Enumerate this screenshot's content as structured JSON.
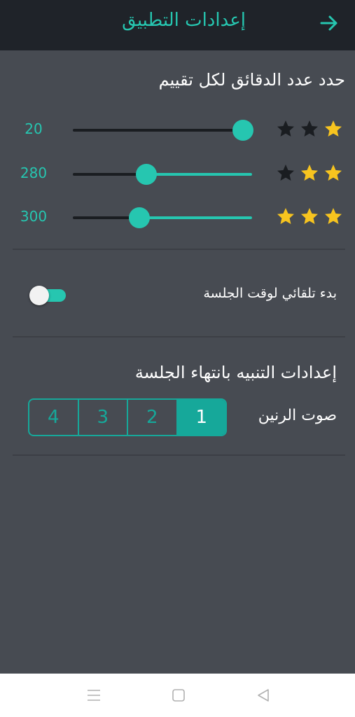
{
  "header": {
    "title": "إعدادات التطبيق",
    "back_icon": "arrow-right-icon"
  },
  "minutes_section": {
    "title": "حدد عدد الدقائق لكل تقييم",
    "rows": [
      {
        "value": "20",
        "stars_filled": 1,
        "stars_total": 3,
        "slider_fraction": 0.95
      },
      {
        "value": "280",
        "stars_filled": 2,
        "stars_total": 3,
        "slider_fraction": 0.41
      },
      {
        "value": "300",
        "stars_filled": 3,
        "stars_total": 3,
        "slider_fraction": 0.37
      }
    ]
  },
  "auto_start": {
    "label": "بدء تلقائي لوقت الجلسة",
    "enabled": false
  },
  "alert_section": {
    "title": "إعدادات التنبيه بانتهاء الجلسة",
    "sound_label": "صوت الرنين",
    "options": [
      "1",
      "2",
      "3",
      "4"
    ],
    "selected": "1"
  },
  "navbar": {
    "icons": [
      "menu-icon",
      "home-square-icon",
      "back-triangle-icon"
    ]
  },
  "colors": {
    "accent": "#26c6b0",
    "segment_accent": "#16a89a",
    "star_filled": "#f7c41f",
    "star_empty": "#1a1d21",
    "background": "#474b52",
    "header": "#1f2329"
  }
}
